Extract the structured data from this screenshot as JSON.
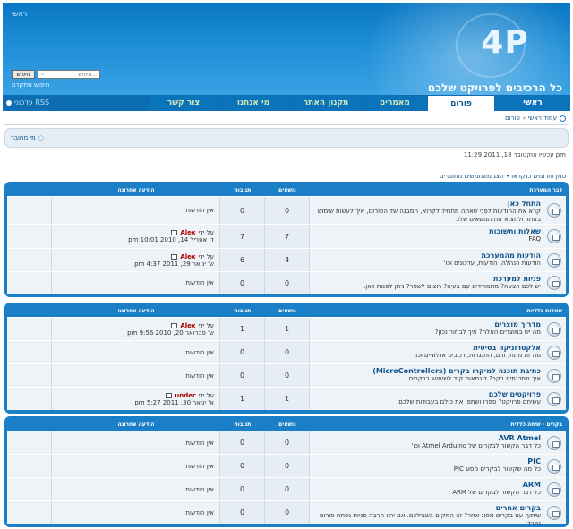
{
  "header": {
    "logo": "4P",
    "slogan": "כל הרכיבים לפרויקט שלכם",
    "top_link": "ראשי",
    "search_button": "חיפוש",
    "search_placeholder": "חיפוש...",
    "advanced_search": "חיפוש מתקדם"
  },
  "nav": {
    "items": [
      {
        "label": "ראשי"
      },
      {
        "label": "פורום"
      },
      {
        "label": "מאמרים"
      },
      {
        "label": "תקנון האתר"
      },
      {
        "label": "מי אנחנו"
      },
      {
        "label": "צור קשר"
      }
    ],
    "active_index": 1,
    "rss_label": "עדכוני RSS"
  },
  "breadcrumb": [
    "עמוד ראשי",
    "פורום"
  ],
  "infobar": {
    "who_online": "מי מחובר"
  },
  "time_text": "עכשיו אוקטובר 18, 2011 11:29 pm",
  "mark_read": "סמן פורומים כנקראו • הצג משתמשים מחוברים",
  "categories": [
    {
      "name": "דבר המערכת",
      "headers": {
        "topics": "נושאים",
        "posts": "תגובות",
        "last": "הודעה אחרונה"
      },
      "forums": [
        {
          "title": "התחל כאן",
          "desc": "קרא את ההודעות לפני שאתה מתחיל לקרוא, המבנה של הפורום, איך לעשות שימוש באתר ולמצוא את הנושאים שלו.",
          "topics": "0",
          "posts": "0",
          "last_none": "אין הודעות"
        },
        {
          "title": "שאלות ותשובות",
          "desc": "FAQ",
          "topics": "7",
          "posts": "7",
          "last_by_prefix": "על ידי",
          "last_user": "Alex",
          "last_time": "ד' אפריל 14, 2010 10:01 pm"
        },
        {
          "title": "הודעות מהמערכת",
          "desc": "הודעות הנהלה, הודעות, עדכונים וכו'",
          "topics": "4",
          "posts": "6",
          "last_by_prefix": "על ידי",
          "last_user": "Alex",
          "last_time": "ש' ינואר 29, 2011 4:37 pm"
        },
        {
          "title": "פניות למערכת",
          "desc": "יש לכם הצעה? מתמודדים עם בעיה? רוצים לשפר? ניתן לפנות כאן.",
          "topics": "0",
          "posts": "0",
          "last_none": "אין הודעות"
        }
      ]
    },
    {
      "name": "שאלות כלליות",
      "headers": {
        "topics": "נושאים",
        "posts": "תגובות",
        "last": "הודעה אחרונה"
      },
      "forums": [
        {
          "title": "מדריך מוצרים",
          "desc": "מה יש במוצרים האלה? איך לבחור נכון?",
          "topics": "1",
          "posts": "1",
          "last_by_prefix": "על ידי",
          "last_user": "Alex",
          "last_time": "ש' פברואר 20, 2010 9:56 pm"
        },
        {
          "title": "אלקטרוניקה בסיסית",
          "desc": "מה זה מתח, זרם, התנגדות, רכיבים אנלוגיים וכו'",
          "topics": "0",
          "posts": "0",
          "last_none": "אין הודעות"
        },
        {
          "title": "כתיבת תוכנה למיקרו בקרים (MicroControllers)",
          "desc": "איך מתכנתים בקר? דוגמאות קוד לשימוש בבקרים",
          "topics": "0",
          "posts": "0",
          "last_none": "אין הודעות"
        },
        {
          "title": "פרויקטים שלכם",
          "desc": "עשיתם פרויקט? ספרו ושתפו את כולם בעבודות שלכם",
          "topics": "1",
          "posts": "1",
          "last_by_prefix": "על ידי",
          "last_user": "under",
          "last_time": "א' ינואר 30, 2011 5:27 pm"
        }
      ]
    },
    {
      "name": "בקרים - שיחה כללית",
      "headers": {
        "topics": "נושאים",
        "posts": "תגובות",
        "last": "הודעה אחרונה"
      },
      "forums": [
        {
          "title": "AVR Atmel",
          "desc": "כל דבר הקשור לבקרים של Atmel Arduino וכו'",
          "topics": "0",
          "posts": "0",
          "last_none": "אין הודעות"
        },
        {
          "title": "PIC",
          "desc": "כל מה שקשור לבקרים מסוג PIC",
          "topics": "0",
          "posts": "0",
          "last_none": "אין הודעות"
        },
        {
          "title": "ARM",
          "desc": "כל דבר הקשור לבקרים של ARM",
          "topics": "0",
          "posts": "0",
          "last_none": "אין הודעות"
        },
        {
          "title": "בקרים אחרים",
          "desc": "שיתוף עם בקרים מסוג אחר? זה המקום בשבילכם. אם יהיו הרבה פניות נפתח פורום נפרד.",
          "topics": "0",
          "posts": "0",
          "last_none": "אין הודעות"
        }
      ]
    }
  ],
  "colors": {
    "brand": "#0a78c4",
    "table_header": "#1a7fc6",
    "row_bg": "#eef3f8",
    "username": "#aa0000",
    "link": "#105289"
  }
}
